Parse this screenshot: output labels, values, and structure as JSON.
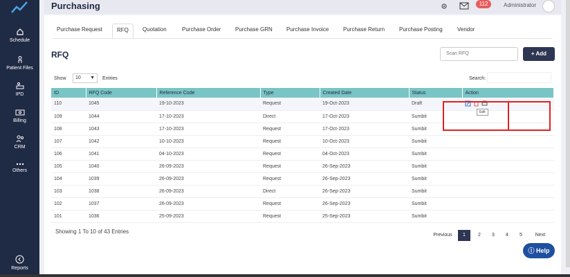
{
  "header": {
    "title": "Purchasing",
    "notification_count": "112",
    "user": "Administrator"
  },
  "sidebar": {
    "items": [
      {
        "label": "Schedule",
        "icon": "home-icon"
      },
      {
        "label": "Patient Files",
        "icon": "person-icon"
      },
      {
        "label": "IPD",
        "icon": "bed-icon"
      },
      {
        "label": "Billing",
        "icon": "money-icon"
      },
      {
        "label": "CRM",
        "icon": "people-icon"
      },
      {
        "label": "Others",
        "icon": "dots-icon"
      },
      {
        "label": "Reports",
        "icon": "chevron-left-icon"
      }
    ]
  },
  "tabs": [
    "Purchase Request",
    "RFQ",
    "Quotation",
    "Purchase Order",
    "Purchase GRN",
    "Purchase Invoice",
    "Purchase Return",
    "Purchase Posting",
    "Vendor"
  ],
  "active_tab": "RFQ",
  "section_title": "RFQ",
  "scan_placeholder": "Scan RFQ",
  "add_label": "+ Add",
  "show_label": "Show",
  "show_value": "10",
  "entries_label": "Entries",
  "search_label": "Search:",
  "table": {
    "columns": [
      "ID",
      "RFQ Code",
      "Reference Code",
      "Type",
      "Created Date",
      "Status",
      "Action"
    ],
    "rows": [
      [
        "110",
        "1045",
        "19-10-2023",
        "Request",
        "19-Oct-2023",
        "Draft"
      ],
      [
        "109",
        "1044",
        "17-10-2023",
        "Direct",
        "17-Oct-2023",
        "Sumbit"
      ],
      [
        "108",
        "1043",
        "17-10-2023",
        "Request",
        "17-Oct-2023",
        "Sumbit"
      ],
      [
        "107",
        "1042",
        "10-10-2023",
        "Request",
        "10-Oct-2023",
        "Sumbit"
      ],
      [
        "106",
        "1041",
        "04-10-2023",
        "Request",
        "04-Oct-2023",
        "Sumbit"
      ],
      [
        "105",
        "1040",
        "26-09-2023",
        "Request",
        "26-Sep-2023",
        "Sumbit"
      ],
      [
        "104",
        "1039",
        "26-09-2023",
        "Request",
        "26-Sep-2023",
        "Sumbit"
      ],
      [
        "103",
        "1038",
        "26-09-2023",
        "Direct",
        "26-Sep-2023",
        "Sumbit"
      ],
      [
        "102",
        "1037",
        "26-09-2023",
        "Request",
        "26-Sep-2023",
        "Sumbit"
      ],
      [
        "101",
        "1036",
        "25-09-2023",
        "Request",
        "25-Sep-2023",
        "Sumbit"
      ]
    ],
    "tooltip": "Edit"
  },
  "showing_text": "Showing 1 To 10 of 43 Entries",
  "pagination": {
    "previous": "Previous",
    "pages": [
      "1",
      "2",
      "3",
      "4",
      "5"
    ],
    "next": "Next",
    "current": "1"
  },
  "help_label": "Help",
  "colors": {
    "sidebar": "#1f2a44",
    "header_row": "#79c4c4",
    "accent": "#2d3652",
    "highlight": "#e02020"
  }
}
